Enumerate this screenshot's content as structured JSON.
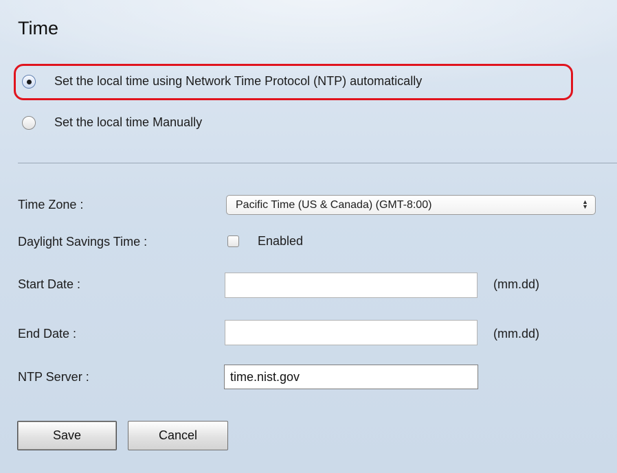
{
  "page": {
    "title": "Time"
  },
  "time_mode": {
    "options": [
      {
        "label": "Set the local time using Network Time Protocol (NTP) automatically",
        "selected": true
      },
      {
        "label": "Set the local time Manually",
        "selected": false
      }
    ]
  },
  "form": {
    "time_zone": {
      "label": "Time Zone :",
      "selected": "Pacific Time (US & Canada) (GMT-8:00)"
    },
    "dst": {
      "label": "Daylight Savings Time :",
      "checkbox_label": "Enabled",
      "checked": false
    },
    "start_date": {
      "label": "Start Date :",
      "value": "",
      "unit": "(mm.dd)"
    },
    "end_date": {
      "label": "End Date :",
      "value": "",
      "unit": "(mm.dd)"
    },
    "ntp_server": {
      "label": "NTP Server :",
      "value": "time.nist.gov"
    }
  },
  "actions": {
    "save_label": "Save",
    "cancel_label": "Cancel"
  },
  "colors": {
    "highlight": "#e0141e",
    "background": "#d1deec"
  },
  "icons": {
    "select_arrow": "select-updown-icon"
  }
}
